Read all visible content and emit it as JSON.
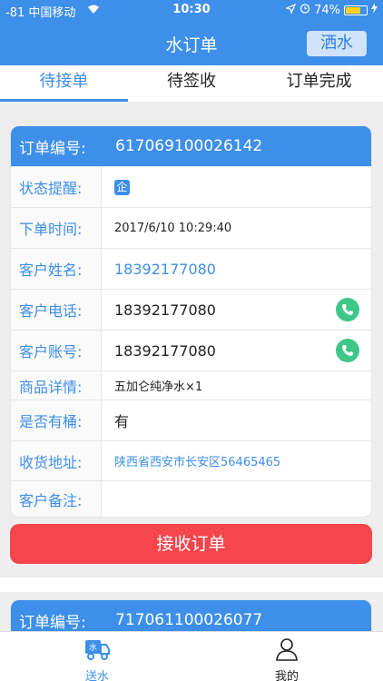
{
  "statusbar": {
    "signal_carrier": "-81 中国移动",
    "time": "10:30",
    "battery_percent": "74%",
    "battery_level": 0.74
  },
  "navbar": {
    "title": "水订单",
    "right_button": "洒水"
  },
  "tabs": [
    {
      "label": "待接单",
      "active": true
    },
    {
      "label": "待签收",
      "active": false
    },
    {
      "label": "订单完成",
      "active": false
    }
  ],
  "orders": [
    {
      "number_label": "订单编号:",
      "number": "617069100026142",
      "rows": [
        {
          "label": "状态提醒:",
          "value": "企"
        },
        {
          "label": "下单时间:",
          "value": "2017/6/10 10:29:40"
        },
        {
          "label": "客户姓名:",
          "value": "18392177080"
        },
        {
          "label": "客户电话:",
          "value": "18392177080"
        },
        {
          "label": "客户账号:",
          "value": "18392177080"
        },
        {
          "label": "商品详情:",
          "value": "五加仑纯净水×1"
        },
        {
          "label": "是否有桶:",
          "value": "有"
        },
        {
          "label": "收货地址:",
          "value": "陕西省西安市长安区56465465"
        },
        {
          "label": "客户备注:",
          "value": ""
        }
      ],
      "action": "接收订单"
    },
    {
      "number_label": "订单编号:",
      "number": "717061100026077"
    }
  ],
  "tabbar": [
    {
      "label": "送水",
      "icon": "delivery-truck-icon",
      "active": true
    },
    {
      "label": "我的",
      "icon": "user-icon",
      "active": false
    }
  ],
  "colors": {
    "primary": "#3d8fe9",
    "accept": "#f5454d",
    "phone": "#3fc789"
  }
}
